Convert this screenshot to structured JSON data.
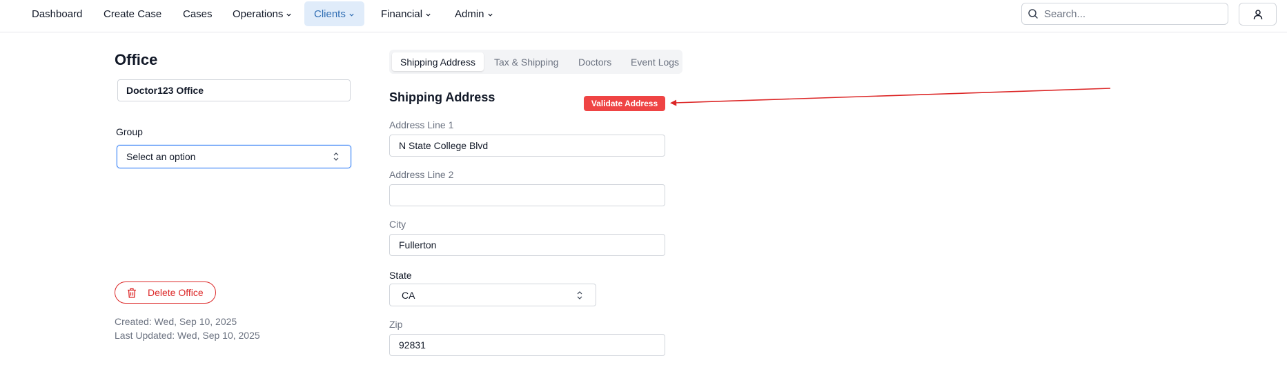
{
  "nav": {
    "items": [
      {
        "label": "Dashboard",
        "has_menu": false
      },
      {
        "label": "Create Case",
        "has_menu": false
      },
      {
        "label": "Cases",
        "has_menu": false
      },
      {
        "label": "Operations",
        "has_menu": true
      },
      {
        "label": "Clients",
        "has_menu": true,
        "active": true
      },
      {
        "label": "Financial",
        "has_menu": true
      },
      {
        "label": "Admin",
        "has_menu": true
      }
    ],
    "search_placeholder": "Search...",
    "icons": {
      "search": "search-icon",
      "user": "user-icon",
      "menu": "chevron-down-icon"
    }
  },
  "office": {
    "title": "Office",
    "name_value": "Doctor123 Office",
    "group_label": "Group",
    "group_value": "Select an option",
    "delete_label": "Delete Office",
    "created": "Created: Wed, Sep 10, 2025",
    "updated": "Last Updated: Wed, Sep 10, 2025"
  },
  "tabs": [
    {
      "label": "Shipping Address",
      "active": true
    },
    {
      "label": "Tax & Shipping",
      "active": false
    },
    {
      "label": "Doctors",
      "active": false
    },
    {
      "label": "Event Logs",
      "active": false
    }
  ],
  "shipping": {
    "title": "Shipping Address",
    "validate_label": "Validate Address",
    "address1_label": "Address Line 1",
    "address1_value": "N State College Blvd",
    "address2_label": "Address Line 2",
    "address2_value": "",
    "city_label": "City",
    "city_value": "Fullerton",
    "state_label": "State",
    "state_value": "CA",
    "zip_label": "Zip",
    "zip_value": "92831"
  },
  "colors": {
    "accent": "#2f6db3",
    "active_nav_bg": "#e0ecfa",
    "danger": "#dc2626",
    "validate_bg": "#ef4444",
    "annotation_arrow": "#dc2626"
  }
}
